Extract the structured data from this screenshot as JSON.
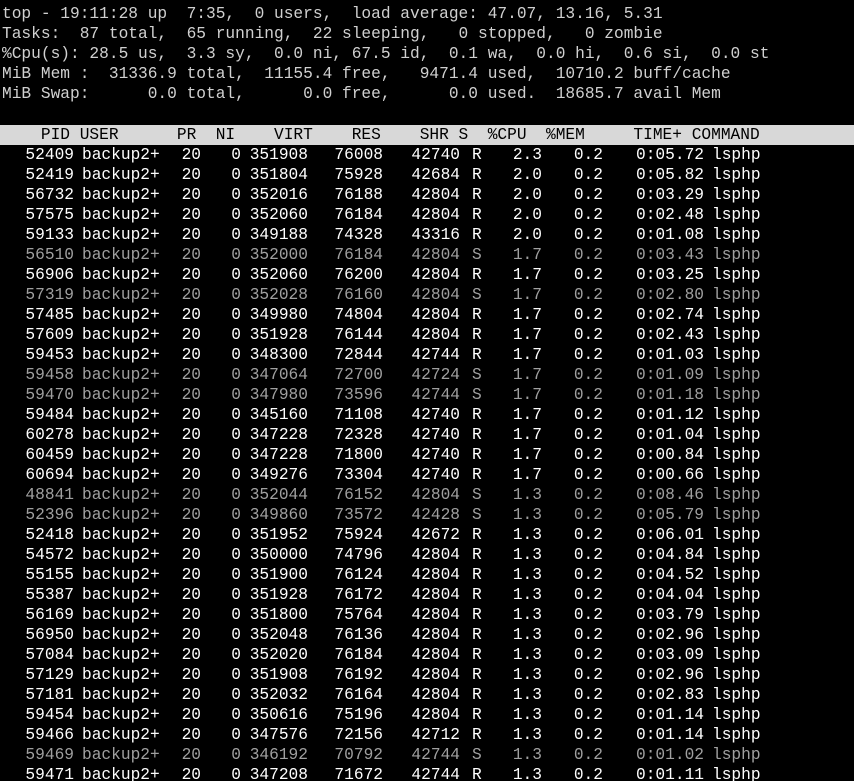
{
  "summary": {
    "line1": "top - 19:11:28 up  7:35,  0 users,  load average: 47.07, 13.16, 5.31",
    "line2": "Tasks:  87 total,  65 running,  22 sleeping,   0 stopped,   0 zombie",
    "line3": "%Cpu(s): 28.5 us,  3.3 sy,  0.0 ni, 67.5 id,  0.1 wa,  0.0 hi,  0.6 si,  0.0 st",
    "line4": "MiB Mem :  31336.9 total,  11155.4 free,   9471.4 used,  10710.2 buff/cache",
    "line5": "MiB Swap:      0.0 total,      0.0 free,      0.0 used.  18685.7 avail Mem"
  },
  "table_header": "    PID USER      PR  NI    VIRT    RES    SHR S  %CPU  %MEM     TIME+ COMMAND",
  "columns": [
    "PID",
    "USER",
    "PR",
    "NI",
    "VIRT",
    "RES",
    "SHR",
    "S",
    "%CPU",
    "%MEM",
    "TIME+",
    "COMMAND"
  ],
  "processes": [
    {
      "pid": "52409",
      "user": "backup2+",
      "pr": "20",
      "ni": "0",
      "virt": "351908",
      "res": "76008",
      "shr": "42740",
      "s": "R",
      "cpu": "2.3",
      "mem": "0.2",
      "time": "0:05.72",
      "cmd": "lsphp"
    },
    {
      "pid": "52419",
      "user": "backup2+",
      "pr": "20",
      "ni": "0",
      "virt": "351804",
      "res": "75928",
      "shr": "42684",
      "s": "R",
      "cpu": "2.0",
      "mem": "0.2",
      "time": "0:05.82",
      "cmd": "lsphp"
    },
    {
      "pid": "56732",
      "user": "backup2+",
      "pr": "20",
      "ni": "0",
      "virt": "352016",
      "res": "76188",
      "shr": "42804",
      "s": "R",
      "cpu": "2.0",
      "mem": "0.2",
      "time": "0:03.29",
      "cmd": "lsphp"
    },
    {
      "pid": "57575",
      "user": "backup2+",
      "pr": "20",
      "ni": "0",
      "virt": "352060",
      "res": "76184",
      "shr": "42804",
      "s": "R",
      "cpu": "2.0",
      "mem": "0.2",
      "time": "0:02.48",
      "cmd": "lsphp"
    },
    {
      "pid": "59133",
      "user": "backup2+",
      "pr": "20",
      "ni": "0",
      "virt": "349188",
      "res": "74328",
      "shr": "43316",
      "s": "R",
      "cpu": "2.0",
      "mem": "0.2",
      "time": "0:01.08",
      "cmd": "lsphp"
    },
    {
      "pid": "56510",
      "user": "backup2+",
      "pr": "20",
      "ni": "0",
      "virt": "352000",
      "res": "76184",
      "shr": "42804",
      "s": "S",
      "cpu": "1.7",
      "mem": "0.2",
      "time": "0:03.43",
      "cmd": "lsphp"
    },
    {
      "pid": "56906",
      "user": "backup2+",
      "pr": "20",
      "ni": "0",
      "virt": "352060",
      "res": "76200",
      "shr": "42804",
      "s": "R",
      "cpu": "1.7",
      "mem": "0.2",
      "time": "0:03.25",
      "cmd": "lsphp"
    },
    {
      "pid": "57319",
      "user": "backup2+",
      "pr": "20",
      "ni": "0",
      "virt": "352028",
      "res": "76160",
      "shr": "42804",
      "s": "S",
      "cpu": "1.7",
      "mem": "0.2",
      "time": "0:02.80",
      "cmd": "lsphp"
    },
    {
      "pid": "57485",
      "user": "backup2+",
      "pr": "20",
      "ni": "0",
      "virt": "349980",
      "res": "74804",
      "shr": "42804",
      "s": "R",
      "cpu": "1.7",
      "mem": "0.2",
      "time": "0:02.74",
      "cmd": "lsphp"
    },
    {
      "pid": "57609",
      "user": "backup2+",
      "pr": "20",
      "ni": "0",
      "virt": "351928",
      "res": "76144",
      "shr": "42804",
      "s": "R",
      "cpu": "1.7",
      "mem": "0.2",
      "time": "0:02.43",
      "cmd": "lsphp"
    },
    {
      "pid": "59453",
      "user": "backup2+",
      "pr": "20",
      "ni": "0",
      "virt": "348300",
      "res": "72844",
      "shr": "42744",
      "s": "R",
      "cpu": "1.7",
      "mem": "0.2",
      "time": "0:01.03",
      "cmd": "lsphp"
    },
    {
      "pid": "59458",
      "user": "backup2+",
      "pr": "20",
      "ni": "0",
      "virt": "347064",
      "res": "72700",
      "shr": "42724",
      "s": "S",
      "cpu": "1.7",
      "mem": "0.2",
      "time": "0:01.09",
      "cmd": "lsphp"
    },
    {
      "pid": "59470",
      "user": "backup2+",
      "pr": "20",
      "ni": "0",
      "virt": "347980",
      "res": "73596",
      "shr": "42744",
      "s": "S",
      "cpu": "1.7",
      "mem": "0.2",
      "time": "0:01.18",
      "cmd": "lsphp"
    },
    {
      "pid": "59484",
      "user": "backup2+",
      "pr": "20",
      "ni": "0",
      "virt": "345160",
      "res": "71108",
      "shr": "42740",
      "s": "R",
      "cpu": "1.7",
      "mem": "0.2",
      "time": "0:01.12",
      "cmd": "lsphp"
    },
    {
      "pid": "60278",
      "user": "backup2+",
      "pr": "20",
      "ni": "0",
      "virt": "347228",
      "res": "72328",
      "shr": "42740",
      "s": "R",
      "cpu": "1.7",
      "mem": "0.2",
      "time": "0:01.04",
      "cmd": "lsphp"
    },
    {
      "pid": "60459",
      "user": "backup2+",
      "pr": "20",
      "ni": "0",
      "virt": "347228",
      "res": "71800",
      "shr": "42740",
      "s": "R",
      "cpu": "1.7",
      "mem": "0.2",
      "time": "0:00.84",
      "cmd": "lsphp"
    },
    {
      "pid": "60694",
      "user": "backup2+",
      "pr": "20",
      "ni": "0",
      "virt": "349276",
      "res": "73304",
      "shr": "42740",
      "s": "R",
      "cpu": "1.7",
      "mem": "0.2",
      "time": "0:00.66",
      "cmd": "lsphp"
    },
    {
      "pid": "48841",
      "user": "backup2+",
      "pr": "20",
      "ni": "0",
      "virt": "352044",
      "res": "76152",
      "shr": "42804",
      "s": "S",
      "cpu": "1.3",
      "mem": "0.2",
      "time": "0:08.46",
      "cmd": "lsphp"
    },
    {
      "pid": "52396",
      "user": "backup2+",
      "pr": "20",
      "ni": "0",
      "virt": "349860",
      "res": "73572",
      "shr": "42428",
      "s": "S",
      "cpu": "1.3",
      "mem": "0.2",
      "time": "0:05.79",
      "cmd": "lsphp"
    },
    {
      "pid": "52418",
      "user": "backup2+",
      "pr": "20",
      "ni": "0",
      "virt": "351952",
      "res": "75924",
      "shr": "42672",
      "s": "R",
      "cpu": "1.3",
      "mem": "0.2",
      "time": "0:06.01",
      "cmd": "lsphp"
    },
    {
      "pid": "54572",
      "user": "backup2+",
      "pr": "20",
      "ni": "0",
      "virt": "350000",
      "res": "74796",
      "shr": "42804",
      "s": "R",
      "cpu": "1.3",
      "mem": "0.2",
      "time": "0:04.84",
      "cmd": "lsphp"
    },
    {
      "pid": "55155",
      "user": "backup2+",
      "pr": "20",
      "ni": "0",
      "virt": "351900",
      "res": "76124",
      "shr": "42804",
      "s": "R",
      "cpu": "1.3",
      "mem": "0.2",
      "time": "0:04.52",
      "cmd": "lsphp"
    },
    {
      "pid": "55387",
      "user": "backup2+",
      "pr": "20",
      "ni": "0",
      "virt": "351928",
      "res": "76172",
      "shr": "42804",
      "s": "R",
      "cpu": "1.3",
      "mem": "0.2",
      "time": "0:04.04",
      "cmd": "lsphp"
    },
    {
      "pid": "56169",
      "user": "backup2+",
      "pr": "20",
      "ni": "0",
      "virt": "351800",
      "res": "75764",
      "shr": "42804",
      "s": "R",
      "cpu": "1.3",
      "mem": "0.2",
      "time": "0:03.79",
      "cmd": "lsphp"
    },
    {
      "pid": "56950",
      "user": "backup2+",
      "pr": "20",
      "ni": "0",
      "virt": "352048",
      "res": "76136",
      "shr": "42804",
      "s": "R",
      "cpu": "1.3",
      "mem": "0.2",
      "time": "0:02.96",
      "cmd": "lsphp"
    },
    {
      "pid": "57084",
      "user": "backup2+",
      "pr": "20",
      "ni": "0",
      "virt": "352020",
      "res": "76184",
      "shr": "42804",
      "s": "R",
      "cpu": "1.3",
      "mem": "0.2",
      "time": "0:03.09",
      "cmd": "lsphp"
    },
    {
      "pid": "57129",
      "user": "backup2+",
      "pr": "20",
      "ni": "0",
      "virt": "351908",
      "res": "76192",
      "shr": "42804",
      "s": "R",
      "cpu": "1.3",
      "mem": "0.2",
      "time": "0:02.96",
      "cmd": "lsphp"
    },
    {
      "pid": "57181",
      "user": "backup2+",
      "pr": "20",
      "ni": "0",
      "virt": "352032",
      "res": "76164",
      "shr": "42804",
      "s": "R",
      "cpu": "1.3",
      "mem": "0.2",
      "time": "0:02.83",
      "cmd": "lsphp"
    },
    {
      "pid": "59454",
      "user": "backup2+",
      "pr": "20",
      "ni": "0",
      "virt": "350616",
      "res": "75196",
      "shr": "42804",
      "s": "R",
      "cpu": "1.3",
      "mem": "0.2",
      "time": "0:01.14",
      "cmd": "lsphp"
    },
    {
      "pid": "59466",
      "user": "backup2+",
      "pr": "20",
      "ni": "0",
      "virt": "347576",
      "res": "72156",
      "shr": "42712",
      "s": "R",
      "cpu": "1.3",
      "mem": "0.2",
      "time": "0:01.14",
      "cmd": "lsphp"
    },
    {
      "pid": "59469",
      "user": "backup2+",
      "pr": "20",
      "ni": "0",
      "virt": "346192",
      "res": "70792",
      "shr": "42744",
      "s": "S",
      "cpu": "1.3",
      "mem": "0.2",
      "time": "0:01.02",
      "cmd": "lsphp"
    },
    {
      "pid": "59471",
      "user": "backup2+",
      "pr": "20",
      "ni": "0",
      "virt": "347208",
      "res": "71672",
      "shr": "42744",
      "s": "R",
      "cpu": "1.3",
      "mem": "0.2",
      "time": "0:01.11",
      "cmd": "lsphp"
    }
  ],
  "colors": {
    "background": "#000000",
    "running_text": "#ffffff",
    "sleeping_text": "#a0a0a0",
    "header_bar": "#d8d8d8",
    "header_text": "#000000",
    "summary_text": "#d0d0d0"
  }
}
